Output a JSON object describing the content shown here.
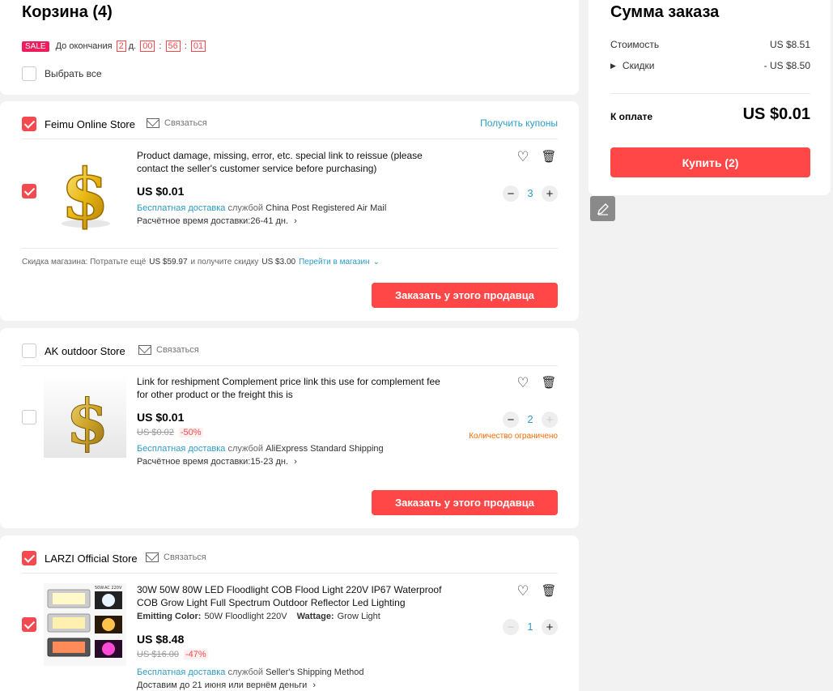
{
  "cart": {
    "title": "Корзина (4)",
    "sale_badge": "SALE",
    "countdown_label": "До окончания",
    "countdown": {
      "days": "2",
      "days_unit": "д.",
      "hours": "00",
      "minutes": "56",
      "seconds": "01"
    },
    "select_all": "Выбрать все"
  },
  "common": {
    "contact": "Связаться",
    "order_from_seller": "Заказать у этого продавца",
    "free_shipping": "Бесплатная доставка",
    "by_service": "службой",
    "eta_label": "Расчётное время доставки:"
  },
  "stores": [
    {
      "name": "Feimu Online Store",
      "checked": true,
      "coupons": "Получить купоны",
      "item": {
        "title": "Product damage, missing, error, etc. special link to reissue (please contact the seller's customer service before purchasing)",
        "price": "US $0.01",
        "shipping_service": "China Post Registered Air Mail",
        "eta": "26-41 дн.",
        "qty": "3",
        "checked": true
      },
      "discount_text": "Скидка магазина: Потратьте ещё",
      "discount_amount": "US $59.97",
      "discount_mid": "и получите скидку",
      "discount_value": "US $3.00",
      "go_to_store": "Перейти в магазин"
    },
    {
      "name": "AK outdoor Store",
      "checked": false,
      "item": {
        "title": "Link for reshipment Complement price link this use for complement fee for other product or the freight this is",
        "price": "US $0.01",
        "old_price": "US $0.02",
        "discount": "-50%",
        "shipping_service": "AliExpress Standard Shipping",
        "eta": "15-23 дн.",
        "qty": "2",
        "limited": "Количество ограничено",
        "checked": false
      }
    },
    {
      "name": "LARZI Official Store",
      "checked": true,
      "item": {
        "title": "30W 50W 80W LED Floodlight COB Flood Light 220V IP67 Waterproof COB Grow Light Full Spectrum Outdoor Reflector Led Lighting",
        "attr1_label": "Emitting Color:",
        "attr1_value": "50W Floodlight 220V",
        "attr2_label": "Wattage:",
        "attr2_value": "Grow Light",
        "price": "US $8.48",
        "old_price": "US $16.00",
        "discount": "-47%",
        "shipping_service": "Seller's Shipping Method",
        "delivery_prefix": "Доставим до",
        "delivery_date": "21 июня",
        "delivery_suffix": "или вернём деньги",
        "qty": "1",
        "checked": true,
        "thumb_labels": [
          "50W",
          "AC 220V"
        ]
      }
    }
  ],
  "summary": {
    "title": "Сумма заказа",
    "cost_label": "Стоимость",
    "cost_value": "US $8.51",
    "discounts_label": "Скидки",
    "discounts_value": "- US $8.50",
    "total_label": "К оплате",
    "total_value": "US $0.01",
    "buy_button": "Купить (2)"
  },
  "colors": {
    "accent": "#ff4747",
    "link": "#2e9cc3",
    "warning": "#ff6a00"
  }
}
